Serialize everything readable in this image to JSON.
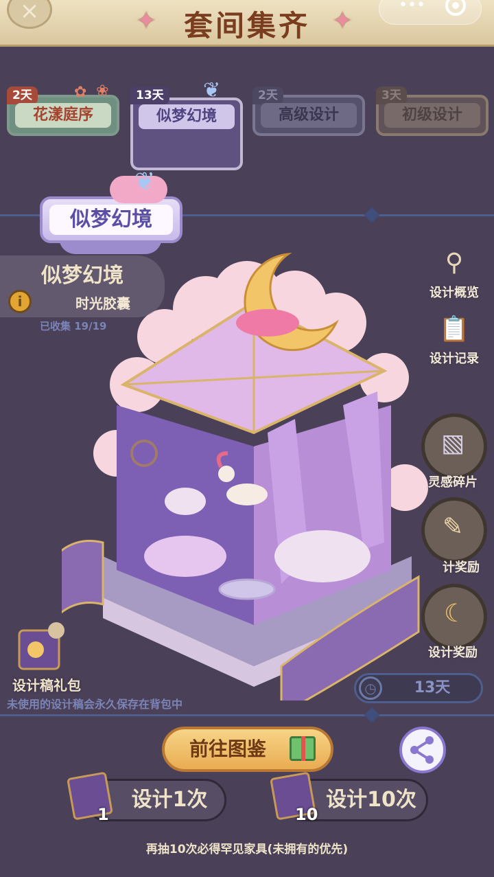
{
  "header": {
    "title": "套间集齐",
    "close_symbol": "×",
    "dots_symbol": "•••"
  },
  "tabs": [
    {
      "name": "花漾庭序",
      "days": "2天",
      "state": "normal"
    },
    {
      "name": "似梦幻境",
      "days": "13天",
      "state": "selected"
    },
    {
      "name": "高级设计",
      "days": "2天",
      "state": "dim"
    },
    {
      "name": "初级设计",
      "days": "3天",
      "state": "dim"
    }
  ],
  "set_info": {
    "badge": "似梦幻境",
    "name": "似梦幻境",
    "info_symbol": "i",
    "subtitle": "时光胶囊",
    "collected": "已收集 19/19"
  },
  "side_buttons": [
    {
      "label": "设计概览",
      "icon": "magnifier-icon"
    },
    {
      "label": "设计记录",
      "icon": "clipboard-icon"
    },
    {
      "label": "灵感碎片",
      "icon": "map-fragment-icon"
    },
    {
      "label": "计奖励",
      "icon": "calendar-pen-icon"
    },
    {
      "label": "设计奖励",
      "icon": "moon-icon"
    }
  ],
  "bottom": {
    "gift_pack_label": "设计稿礼包",
    "note": "未使用的设计稿会永久保存在背包中",
    "timer_label": "13天",
    "timer_symbol": "◷",
    "guide_button": "前往图鉴",
    "draw_once": "设计1次",
    "draw_once_count": "1",
    "draw_ten": "设计10次",
    "draw_ten_count": "10",
    "footer_tip": "再抽10次必得罕见家具(未拥有的优先)"
  },
  "colors": {
    "background": "#4a4057",
    "header": "#efe2c2",
    "title": "#7a3d1f",
    "accent": "#9c8bcd",
    "button_gold": "#e9ac52"
  }
}
